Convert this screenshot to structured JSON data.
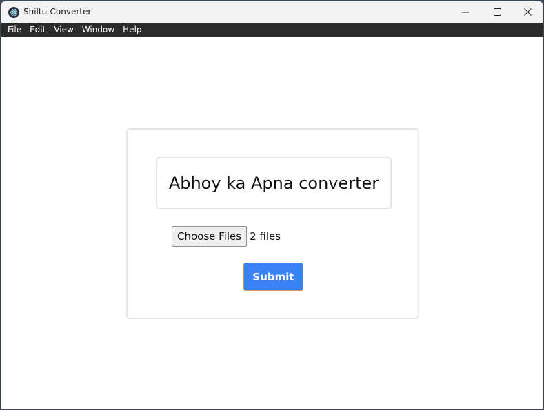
{
  "window": {
    "title": "Shiltu-Converter",
    "app_icon": "electron-icon",
    "controls": [
      "minimize-icon",
      "maximize-icon",
      "close-icon"
    ]
  },
  "menu": {
    "items": [
      "File",
      "Edit",
      "View",
      "Window",
      "Help"
    ]
  },
  "main": {
    "heading": "Abhoy ka Apna converter",
    "file_input": {
      "button_label": "Choose Files",
      "status": "2 files"
    },
    "submit_label": "Submit",
    "colors": {
      "submit_bg": "#3b82f6",
      "menubar_bg": "#2b2b2b"
    }
  }
}
